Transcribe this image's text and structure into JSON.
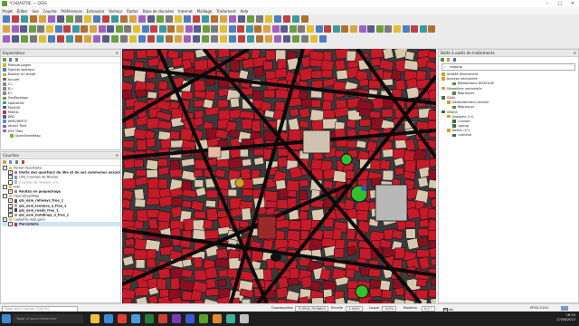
{
  "window": {
    "title": "*CADASTRE — QGIS"
  },
  "menu": [
    "Projet",
    "Éditer",
    "Vue",
    "Couche",
    "Préférences",
    "Extension",
    "Vecteur",
    "Raster",
    "Base de données",
    "Internet",
    "Maillage",
    "Traitement",
    "Aide"
  ],
  "browser": {
    "title": "Explorateur",
    "items": [
      "Marque-pages",
      "Signets spatiaux",
      "Dossier du projet",
      "Accueil",
      "C:\\",
      "D:\\",
      "E:\\",
      "GeoPackage",
      "SpatiaLite",
      "PostGIS",
      "MSSQL",
      "DB2",
      "WMS/WMTS",
      "Vector Tiles",
      "XYZ Tiles",
      "OpenStreetMap"
    ]
  },
  "layers": {
    "title": "Couches",
    "items": [
      {
        "label": "Portail OpenData",
        "indent": 0,
        "checked": true,
        "color": "#f0c040"
      },
      {
        "label": "limite des quartiers de lille et de ses communes associées",
        "indent": 1,
        "checked": true,
        "color": "#c060c0",
        "bold": true
      },
      {
        "label": "Lille_Courbes de Niveau",
        "indent": 1,
        "checked": true,
        "color": "#6a9bd1"
      },
      {
        "label": "Courbes de niveaux 1m",
        "indent": 1,
        "checked": false,
        "color": "#9fb8d8",
        "italic": true
      },
      {
        "label": "IGN",
        "indent": 0,
        "checked": true,
        "color": "#f0c040"
      },
      {
        "label": "Routes en geopackage",
        "indent": 1,
        "checked": true,
        "color": "#8c8c8c",
        "bold": true
      },
      {
        "label": "OpenStreetMap",
        "indent": 0,
        "checked": true,
        "color": "#f0c040"
      },
      {
        "label": "gis_osm_railways_free_1",
        "indent": 1,
        "checked": true,
        "color": "#555555",
        "bold": true
      },
      {
        "label": "gis_osm_landuse_a_free_1",
        "indent": 1,
        "checked": true,
        "color": "#d89a9a",
        "bold": true
      },
      {
        "label": "gis_osm_roads_free_1",
        "indent": 1,
        "checked": true,
        "color": "#444444",
        "bold": true
      },
      {
        "label": "gis_osm_buildings_a_free_1",
        "indent": 1,
        "checked": true,
        "color": "#9a9a9a",
        "bold": true
      },
      {
        "label": "Cadastre.data.gouv",
        "indent": 0,
        "checked": true,
        "color": "#f0c040"
      },
      {
        "label": "Parcellaire",
        "indent": 1,
        "checked": true,
        "color": "#c0304a",
        "bold": true
      }
    ]
  },
  "toolbox": {
    "title": "Boîte à outils de traitements",
    "search_value": "regroup",
    "items": [
      {
        "label": "Utilisés récemment",
        "indent": 0,
        "color": "#c8a040"
      },
      {
        "label": "Analyse vectorielle",
        "indent": 0,
        "color": "#d4a020"
      },
      {
        "label": "Rubberband DISSOLVE",
        "indent": 2,
        "color": "#5a8a3a"
      },
      {
        "label": "Géométrie vectorielle",
        "indent": 0,
        "color": "#d4a020"
      },
      {
        "label": "Regrouper",
        "indent": 2,
        "color": "#5a8a3a"
      },
      {
        "label": "GDAL",
        "indent": 0,
        "color": "#3a7a3a"
      },
      {
        "label": "Géotraitement vecteur",
        "indent": 1,
        "color": "#d4a020"
      },
      {
        "label": "Regrouper",
        "indent": 2,
        "color": "#5a8a3a"
      },
      {
        "label": "GRASS",
        "indent": 0,
        "color": "#3a6a3a"
      },
      {
        "label": "Imagerie (i.*)",
        "indent": 1,
        "color": "#d4a020"
      },
      {
        "label": "i.cluster",
        "indent": 2,
        "color": "#3a6a3a"
      },
      {
        "label": "i.group",
        "indent": 2,
        "color": "#3a6a3a"
      },
      {
        "label": "Raster (r.*)",
        "indent": 1,
        "color": "#d4a020"
      },
      {
        "label": "r.volume",
        "indent": 2,
        "color": "#3a6a3a"
      }
    ]
  },
  "status": {
    "search_placeholder": "Taper pour trouver (Ctrl+K)",
    "coord_label": "Coordonnées",
    "coord_value": "703916,7058690",
    "scale_label": "Échelle",
    "scale_value": "1:4000",
    "magnifier_label": "Loupe",
    "magnifier_value": "100%",
    "rotation_label": "Rotation",
    "rotation_value": "0,0 °",
    "render_label": "Rendu",
    "crs_value": "EPSG:2154"
  },
  "taskbar": {
    "search_placeholder": "Taper ici pour rechercher",
    "time": "16:53",
    "date": "27/06/2022"
  }
}
